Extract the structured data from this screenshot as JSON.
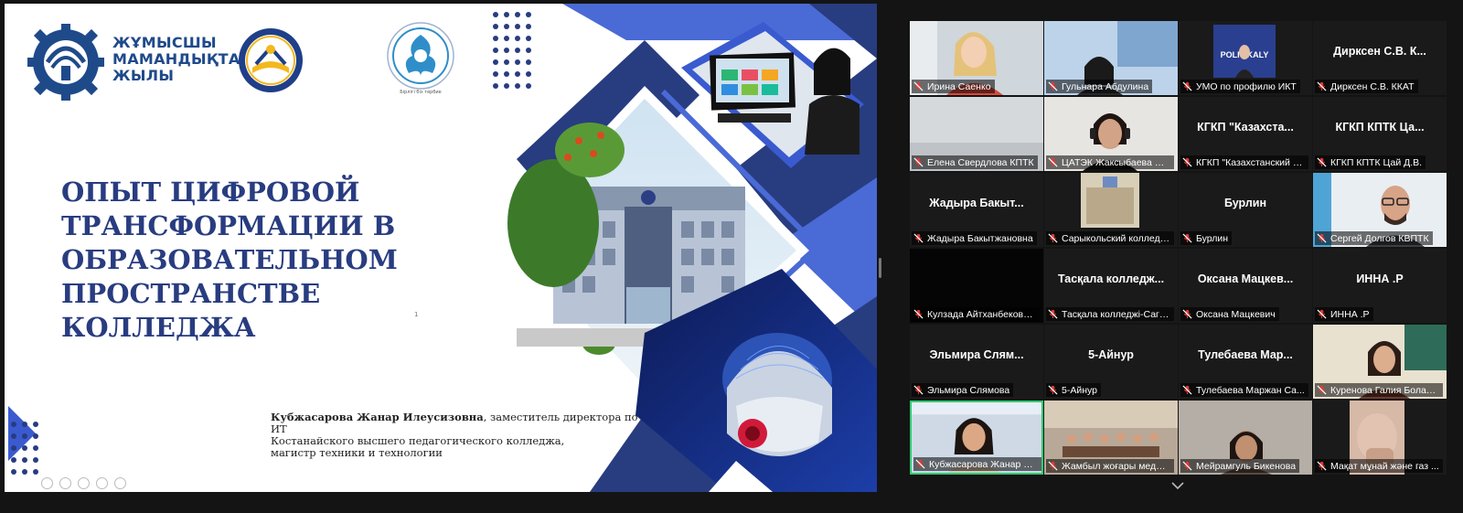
{
  "slide": {
    "logo1_text": [
      "ЖҰМЫСШЫ",
      "МАМАНДЫҚТАР",
      "ЖЫЛЫ"
    ],
    "logo3_caption": "Бірлігі біз тербие",
    "title": "Опыт цифровой трансформации в образовательном пространстве колледжа",
    "page_number": "1",
    "author_name": "Кубжасарова Жанар Илеусизовна",
    "author_role": ", заместитель директора по ИТ",
    "author_line2": "Костанайского высшего педагогического колледжа,",
    "author_line3": "магистр техники и технологии"
  },
  "gallery": {
    "tiles": [
      {
        "name": "Ирина Саенко",
        "video": "woman-office"
      },
      {
        "name": "Гульнара Абдулина",
        "video": "woman-room"
      },
      {
        "name": "УМО по профилю ИКТ",
        "video": "politrikaly"
      },
      {
        "name": "Дирксен С.В. ККАТ",
        "big": "Дирксен С.В. К..."
      },
      {
        "name": "Елена Свердлова КПТК",
        "video": "gray-room"
      },
      {
        "name": "ЦАТЭК Жаксыбаева На...",
        "video": "woman-headset"
      },
      {
        "name": "КГКП \"Казахстанский аг...",
        "big": "КГКП \"Казахста..."
      },
      {
        "name": "КГКП КПТК Цай Д.В.",
        "big": "КГКП КПТК Ца..."
      },
      {
        "name": "Жадыра Бакытжановна",
        "big": "Жадыра Бакыт..."
      },
      {
        "name": "Сарыкольский колледж...",
        "video": "building"
      },
      {
        "name": "Бурлин",
        "big": "Бурлин"
      },
      {
        "name": "Сергей Долгов КВПТК",
        "video": "man-glasses"
      },
      {
        "name": "Кулзада Айтханбековна...",
        "video": "black"
      },
      {
        "name": "Тасқала колледжі-Саги...",
        "big": "Тасқала колледж..."
      },
      {
        "name": "Оксана Мацкевич",
        "big": "Оксана Мацкев..."
      },
      {
        "name": "ИННА .Р",
        "big": "ИННА .Р"
      },
      {
        "name": "Эльмира Слямова",
        "big": "Эльмира Слям..."
      },
      {
        "name": "5-Айнур",
        "big": "5-Айнур"
      },
      {
        "name": "Тулебаева Маржан Са...",
        "big": "Тулебаева Мар..."
      },
      {
        "name": "Куренова Галия Болатк...",
        "video": "woman-light"
      },
      {
        "name": "Кубжасарова Жанар Илеу...",
        "video": "woman-speaker",
        "active": true
      },
      {
        "name": "Жамбыл жоғары медиц...",
        "video": "meeting-room"
      },
      {
        "name": "Мейрамгуль Бикенова",
        "video": "woman-dim"
      },
      {
        "name": "Мақат мұнай және газ ...",
        "video": "hand-face"
      }
    ]
  }
}
